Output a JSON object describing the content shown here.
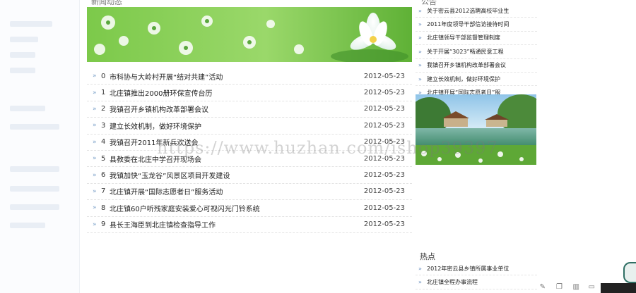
{
  "main": {
    "section_title": "新闻动态",
    "news": [
      {
        "num": "0",
        "title": "市科协与大岭村开展“结对共建”活动",
        "date": "2012-05-23"
      },
      {
        "num": "1",
        "title": "北庄镇推出2000册环保宣传台历",
        "date": "2012-05-23"
      },
      {
        "num": "2",
        "title": "我镇召开乡镇机构改革部署会议",
        "date": "2012-05-23"
      },
      {
        "num": "3",
        "title": "建立长效机制，做好环境保护",
        "date": "2012-05-23"
      },
      {
        "num": "4",
        "title": "我镇召开2011年新兵欢送会",
        "date": "2012-05-23"
      },
      {
        "num": "5",
        "title": "县教委在北庄中学召开现场会",
        "date": "2012-05-23"
      },
      {
        "num": "6",
        "title": "我镇加快“玉龙谷”风景区项目开发建设",
        "date": "2012-05-23"
      },
      {
        "num": "7",
        "title": "北庄镇开展“国际志愿者日”服务活动",
        "date": "2012-05-23"
      },
      {
        "num": "8",
        "title": "北庄镇60户听残家庭安装爱心可视闪光门铃系统",
        "date": "2012-05-23"
      },
      {
        "num": "9",
        "title": "县长王海臣到北庄镇检查指导工作",
        "date": "2012-05-23"
      }
    ]
  },
  "right": {
    "top_title": "公告",
    "notices": [
      "关于密云县2012选聘高校毕业生",
      "2011年度领导干部信访接待时间",
      "北庄镇领导干部监督管理制度",
      "关于开展“3023”畅通民意工程",
      "我镇召开乡镇机构改革部署会议",
      "建立长效机制，做好环境保护",
      "北庄镇开展“国际志愿者日”服"
    ],
    "hot_title": "热点",
    "hot_items": [
      "2012年密云县乡镇所属事业单位",
      "北庄镇全程办事流程"
    ]
  },
  "watermark": "https://www.huzhan.com/ishop39397",
  "colors": {
    "banner_green": "#6cbf3a",
    "bullet_blue": "#7aa0c8"
  }
}
